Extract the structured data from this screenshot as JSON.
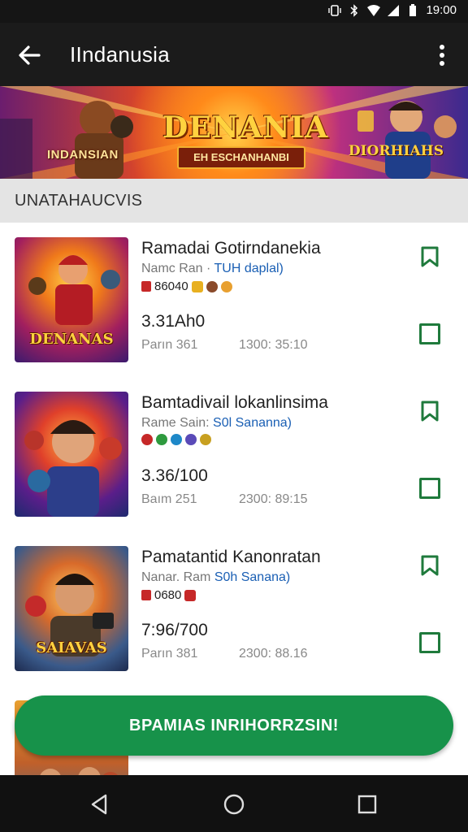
{
  "status_bar": {
    "time": "19:00",
    "icons": [
      "vibrate-icon",
      "bluetooth-icon",
      "wifi-icon",
      "signal-icon",
      "battery-icon"
    ]
  },
  "app_bar": {
    "title": "IIndanusia"
  },
  "banner": {
    "left_text": "INDANSIAN",
    "main_title": "DENANIA",
    "subtitle": "EH ESCHANHANBI",
    "right_text": "DIORHIAHS"
  },
  "section": {
    "header": "UNATAHAUCVIS"
  },
  "items": [
    {
      "thumb_label": "DENANAS",
      "title": "Ramadai Gotirndanekia",
      "sub_prefix": "Namc Ran · ",
      "sub_link": "TUH daplal)",
      "badge_text": "86040",
      "price": "3.31Ah0",
      "meta_left": "Parın 361",
      "meta_right": "1300: 35:10"
    },
    {
      "thumb_label": "",
      "title": "Bamtadivail lokanlinsima",
      "sub_prefix": "Rame Sain: ",
      "sub_link": "S0l Sananna)",
      "badge_text": "",
      "price": "3.36/100",
      "meta_left": "Baım 251",
      "meta_right": "2300: 89:15"
    },
    {
      "thumb_label": "SAIAVAS",
      "title": "Pamatantid Kanonratan",
      "sub_prefix": "Nanar. Ram ",
      "sub_link": "S0h Sanana)",
      "badge_text": "0680",
      "price": "7:96/700",
      "meta_left": "Parın 381",
      "meta_right": "2300: 88.16"
    }
  ],
  "cta": {
    "label": "BPAMIAS INRIHORRZSIN!"
  },
  "colors": {
    "accent": "#17924a",
    "appbar": "#1b1b1b",
    "link": "#1a5fb4"
  }
}
